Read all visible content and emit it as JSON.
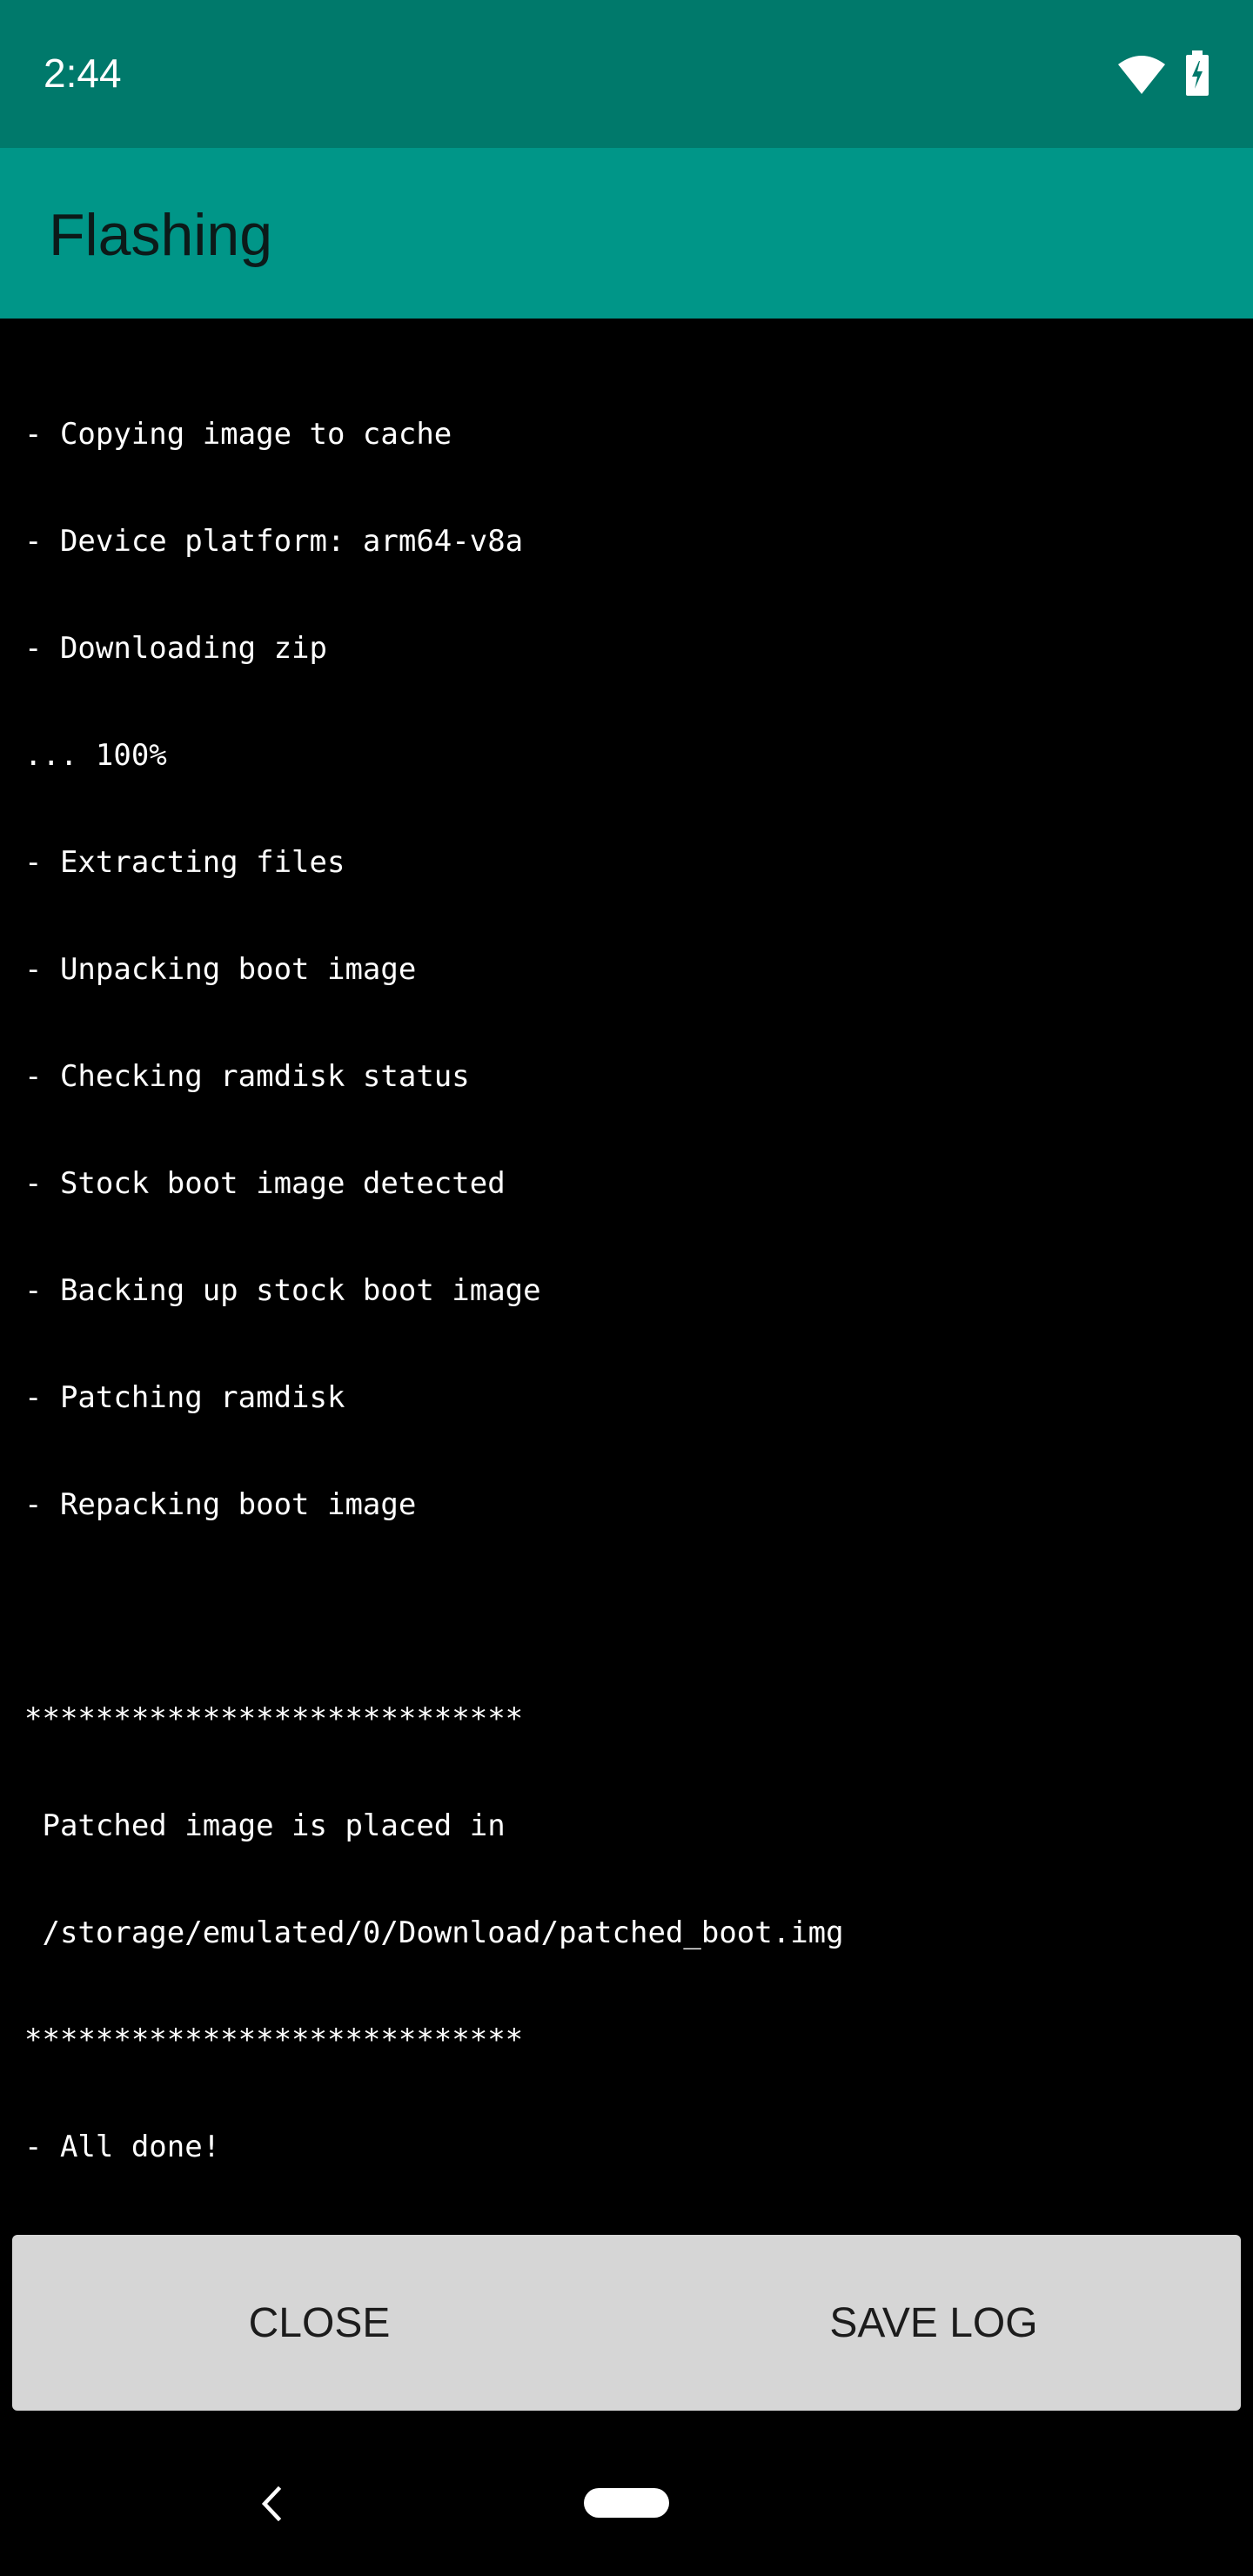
{
  "status_bar": {
    "time": "2:44",
    "icons": [
      "wifi-icon",
      "battery-charging-icon"
    ],
    "color": "#00796b"
  },
  "app_bar": {
    "title": "Flashing",
    "color": "#009688"
  },
  "console": {
    "lines": [
      "- Copying image to cache",
      "- Device platform: arm64-v8a",
      "- Downloading zip",
      "... 100%",
      "- Extracting files",
      "- Unpacking boot image",
      "- Checking ramdisk status",
      "- Stock boot image detected",
      "- Backing up stock boot image",
      "- Patching ramdisk",
      "- Repacking boot image",
      "",
      "****************************",
      " Patched image is placed in",
      " /storage/emulated/0/Download/patched_boot.img",
      "****************************",
      "- All done!"
    ]
  },
  "buttons": {
    "close_label": "CLOSE",
    "save_log_label": "SAVE LOG"
  },
  "nav_bar": {
    "icons": [
      "back-icon",
      "home-pill"
    ]
  }
}
